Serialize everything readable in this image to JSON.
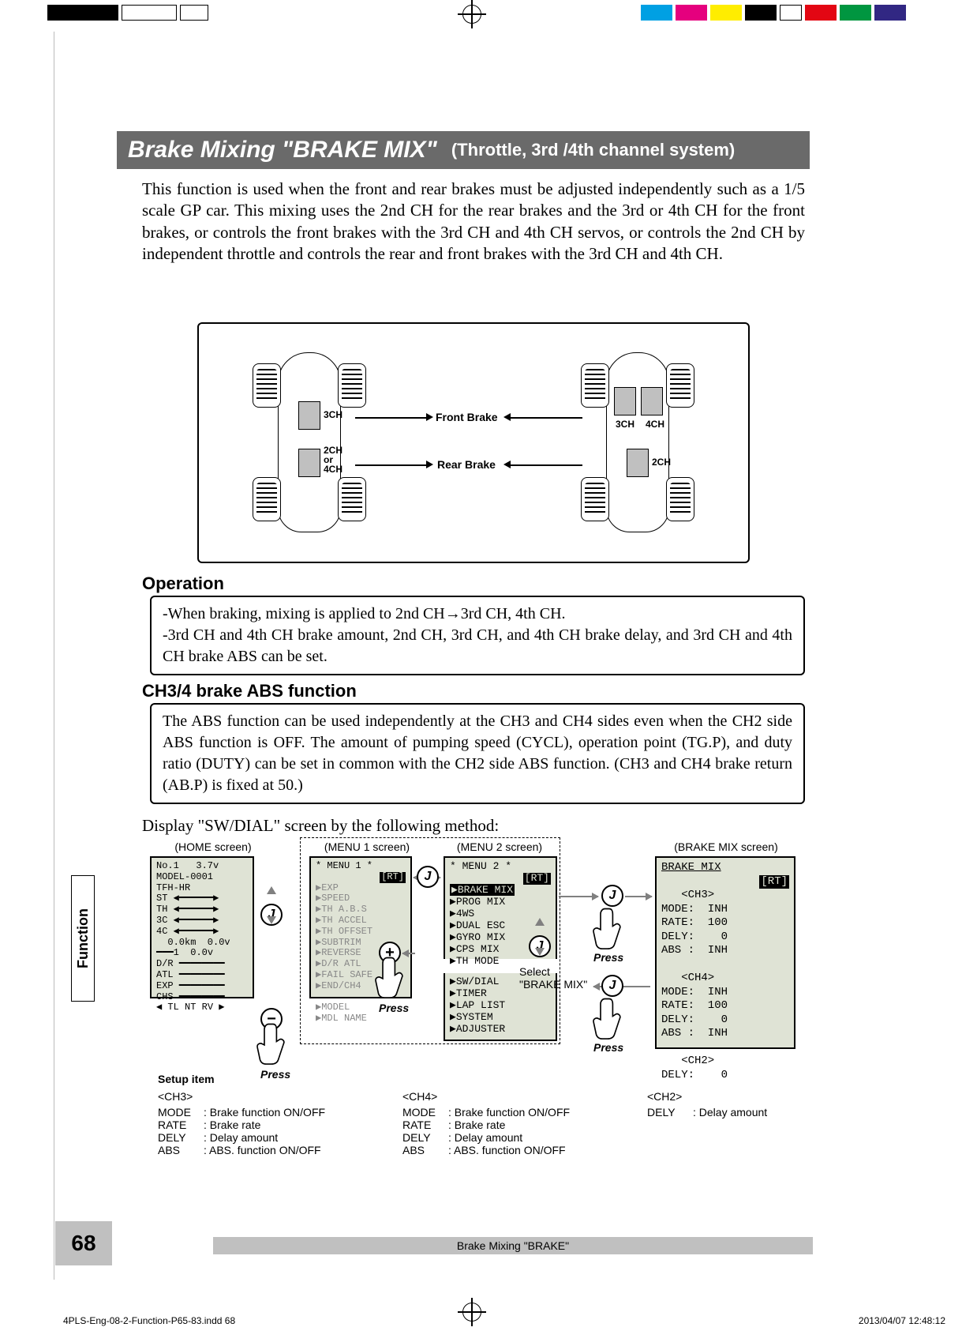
{
  "title": {
    "main": "Brake Mixing  \"BRAKE MIX\"",
    "sub": "(Throttle, 3rd /4th channel system)"
  },
  "intro": "This function is used when the front and rear brakes must be adjusted independently such as a 1/5 scale GP car. This mixing uses the 2nd CH for the rear brakes and the 3rd or 4th CH for the front brakes, or controls the front brakes with the 3rd CH and 4th CH servos, or controls the 2nd CH by independent throttle and controls the rear and front brakes with the 3rd CH and 4th CH.",
  "diagram": {
    "front_brake": "Front Brake",
    "rear_brake": "Rear Brake",
    "left_servo_top_label": "3CH",
    "left_servo_bot_label": "2CH\nor\n4CH",
    "right_servo_tl_label": "3CH",
    "right_servo_tr_label": "4CH",
    "right_servo_bot_label": "2CH"
  },
  "operation": {
    "heading": "Operation",
    "line1": "-When braking, mixing is applied to 2nd CH→3rd CH, 4th CH.",
    "line2": "-3rd CH and 4th CH brake amount, 2nd CH, 3rd CH, and 4th CH brake delay, and 3rd CH and 4th CH brake ABS can be set."
  },
  "abs": {
    "heading": "CH3/4 brake ABS function",
    "text": "The ABS function can be used independently at the CH3 and CH4 sides even when the CH2 side ABS function is OFF. The amount of  pumping speed (CYCL), operation point (TG.P), and duty ratio (DUTY) can be set in common with the CH2 side ABS function. (CH3 and CH4 brake return (AB.P) is fixed at 50.)"
  },
  "nav_intro": "Display \"SW/DIAL\" screen by the following method:",
  "flow": {
    "home_caption": "(HOME screen)",
    "menu1_caption": "(MENU 1 screen)",
    "menu2_caption": "(MENU 2 screen)",
    "brakemix_caption": "(BRAKE MIX screen)",
    "press": "Press",
    "select": "Select",
    "select_target": "\"BRAKE MIX\"",
    "j_label": "J",
    "plus": "+",
    "minus": "−",
    "menu1_title": "* MENU 1 *",
    "menu2_title": "* MENU 2 *",
    "menu2_rt": "[RT]",
    "menu2_items_top": "▶BRAKE MIX\n▶PROG MIX\n▶4WS\n▶DUAL ESC\n▶GYRO MIX\n▶CPS MIX\n▶TH MODE",
    "menu2_items_bot": "▶SW/DIAL\n▶TIMER\n▶LAP LIST\n▶SYSTEM\n▶ADJUSTER",
    "menu1_items": "▶EXP\n▶SPEED\n▶TH A.B.S\n▶TH ACCEL\n▶TH OFFSET\n▶SUBTRIM\n▶REVERSE\n▶D/R ATL\n▶FAIL SAFE\n▶END/CH4\n\n▶MODEL\n▶MDL NAME",
    "menu1_rt": "[RT]",
    "home_model": "No.1   3.7v\nMODEL-0001\nTFH-HR",
    "home_body": "ST ◀━━━━━━▶\nTH ◀━━━━━━▶\n3C ◀━━━━━━▶\n4C ◀━━━━━━▶\n  0.0km  0.0v\n━━━1  0.0v\nD/R ━━━━━━━━\nATL ━━━━━━━━\nEXP ━━━━━━━━\nCHS ━━━━━━━━\n◀ TL NT RV ▶",
    "brakemix_title": "BRAKE MIX",
    "brakemix_rt": "[RT]",
    "brakemix_ch3": "   <CH3>\nMODE:  INH\nRATE:  100\nDELY:    0\nABS :  INH",
    "brakemix_ch4": "   <CH4>\nMODE:  INH\nRATE:  100\nDELY:    0\nABS :  INH",
    "brakemix_ch2": "   <CH2>\nDELY:    0"
  },
  "setup": {
    "heading": "Setup item",
    "ch3_head": "<CH3>",
    "ch4_head": "<CH4>",
    "ch2_head": "<CH2>",
    "ch3": [
      {
        "k": "MODE",
        "v": ": Brake function ON/OFF"
      },
      {
        "k": "RATE",
        "v": ": Brake rate"
      },
      {
        "k": "DELY",
        "v": ": Delay amount"
      },
      {
        "k": "ABS",
        "v": ": ABS. function ON/OFF"
      }
    ],
    "ch4": [
      {
        "k": "MODE",
        "v": ": Brake function ON/OFF"
      },
      {
        "k": "RATE",
        "v": ": Brake rate"
      },
      {
        "k": "DELY",
        "v": ": Delay amount"
      },
      {
        "k": "ABS",
        "v": ": ABS. function ON/OFF"
      }
    ],
    "ch2": [
      {
        "k": "DELY",
        "v": ": Delay amount"
      }
    ]
  },
  "footer": {
    "page_num": "68",
    "caption": "Brake Mixing  \"BRAKE\""
  },
  "side_tab": "Function",
  "meta": {
    "file": "4PLS-Eng-08-2-Function-P65-83.indd   68",
    "timestamp": "2013/04/07   12:48:12"
  }
}
